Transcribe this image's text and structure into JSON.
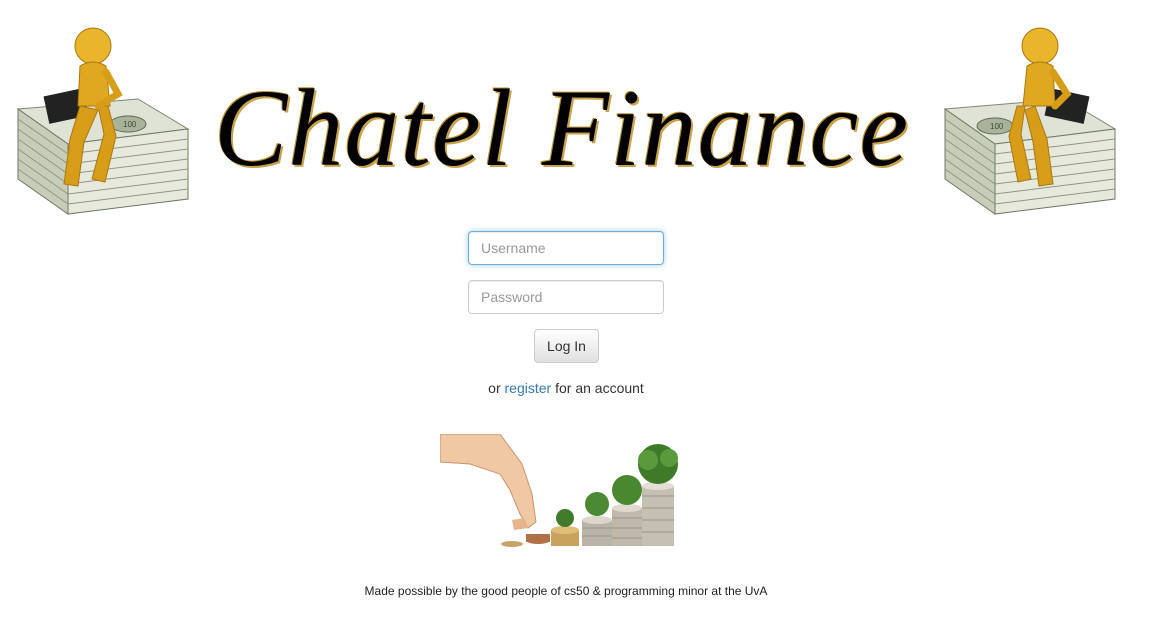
{
  "header": {
    "title": "Chatel Finance",
    "left_art_icon": "gold-figure-on-money-stack-icon",
    "right_art_icon": "gold-figure-on-money-stack-icon"
  },
  "login_form": {
    "username_placeholder": "Username",
    "username_value": "",
    "password_placeholder": "Password",
    "password_value": "",
    "login_button_label": "Log In"
  },
  "register": {
    "prefix": "or",
    "link_text": "register",
    "suffix": "for an account"
  },
  "growth_image_icon": "hand-coins-growth-icon",
  "footer": {
    "text": "Made possible by the good people of cs50 & programming minor at the UvA"
  },
  "colors": {
    "link": "#337ab7",
    "focus_border": "#66afe9",
    "gold": "#d9a520"
  }
}
